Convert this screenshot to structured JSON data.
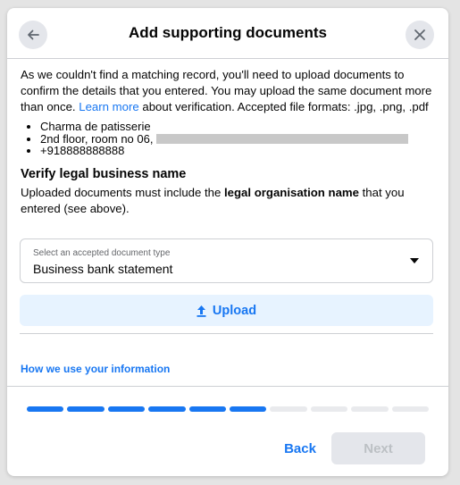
{
  "header": {
    "title": "Add supporting documents",
    "back_icon": "arrow-left-icon",
    "close_icon": "close-icon"
  },
  "intro": {
    "text_before_link": "As we couldn't find a matching record, you'll need to upload documents to confirm the details that you entered. You may upload the same document more than once. ",
    "link_text": "Learn more",
    "text_after_link": " about verification. Accepted file formats: .jpg, .png, .pdf"
  },
  "details": {
    "business_name": "Charma de patisserie",
    "address_visible": "2nd floor, room no 06,",
    "phone": "+918888888888"
  },
  "verify_section": {
    "title": "Verify legal business name",
    "desc_before": "Uploaded documents must include the ",
    "desc_bold": "legal organisation name",
    "desc_after": " that you entered (see above)."
  },
  "document_select": {
    "label": "Select an accepted document type",
    "value": "Business bank statement"
  },
  "upload": {
    "label": "Upload",
    "icon": "upload-arrow-icon"
  },
  "info_link": "How we use your information",
  "progress": {
    "completed_steps": 6,
    "total_steps": 10
  },
  "footer": {
    "back_label": "Back",
    "next_label": "Next"
  },
  "colors": {
    "accent": "#1877f2",
    "upload_bg": "#e7f3ff",
    "disabled_bg": "#e4e6eb",
    "disabled_text": "#bcc0c4"
  }
}
